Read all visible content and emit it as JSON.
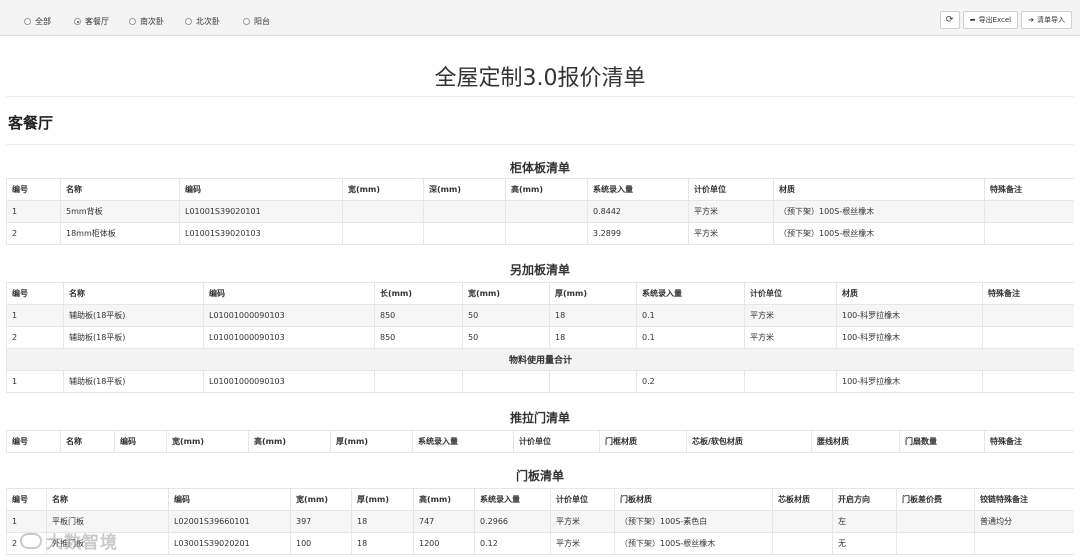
{
  "filters": {
    "options": [
      "全部",
      "客餐厅",
      "南次卧",
      "北次卧",
      "阳台"
    ],
    "selected": "客餐厅"
  },
  "toolbar": {
    "refresh_icon": "refresh-icon",
    "export_label": "导出Excel",
    "import_label": "清单导入"
  },
  "document": {
    "title": "全屋定制3.0报价清单",
    "room": "客餐厅"
  },
  "cabinet_board": {
    "title": "柜体板清单",
    "headers": [
      "编号",
      "名称",
      "编码",
      "宽(mm)",
      "深(mm)",
      "高(mm)",
      "系统录入量",
      "计价单位",
      "材质",
      "特殊备注"
    ],
    "rows": [
      [
        "1",
        "5mm背板",
        "L01001S39020101",
        "",
        "",
        "",
        "0.8442",
        "平方米",
        "（预下架）100S-根丝橡木",
        ""
      ],
      [
        "2",
        "18mm柜体板",
        "L01001S39020103",
        "",
        "",
        "",
        "3.2899",
        "平方米",
        "（预下架）100S-根丝橡木",
        ""
      ]
    ]
  },
  "extra_board": {
    "title": "另加板清单",
    "headers": [
      "编号",
      "名称",
      "编码",
      "长(mm)",
      "宽(mm)",
      "厚(mm)",
      "系统录入量",
      "计价单位",
      "材质",
      "特殊备注"
    ],
    "rows": [
      [
        "1",
        "辅助板(18平板)",
        "L01001000090103",
        "850",
        "50",
        "18",
        "0.1",
        "平方米",
        "100-科罗拉橡木",
        ""
      ],
      [
        "2",
        "辅助板(18平板)",
        "L01001000090103",
        "850",
        "50",
        "18",
        "0.1",
        "平方米",
        "100-科罗拉橡木",
        ""
      ]
    ],
    "summary_title": "物料使用量合计",
    "summary_rows": [
      [
        "1",
        "辅助板(18平板)",
        "L01001000090103",
        "",
        "",
        "",
        "0.2",
        "",
        "100-科罗拉橡木",
        ""
      ]
    ]
  },
  "sliding_door": {
    "title": "推拉门清单",
    "headers": [
      "编号",
      "名称",
      "编码",
      "宽(mm)",
      "高(mm)",
      "厚(mm)",
      "系统录入量",
      "计价单位",
      "门框材质",
      "芯板/软包材质",
      "腰线材质",
      "门扇数量",
      "特殊备注"
    ]
  },
  "door_panel": {
    "title": "门板清单",
    "headers": [
      "编号",
      "名称",
      "编码",
      "宽(mm)",
      "厚(mm)",
      "高(mm)",
      "系统录入量",
      "计价单位",
      "门板材质",
      "芯板材质",
      "开启方向",
      "门板差价费",
      "铰链特殊备注"
    ],
    "rows": [
      [
        "1",
        "平板门板",
        "L02001S39660101",
        "397",
        "18",
        "747",
        "0.2966",
        "平方米",
        "（预下架）100S-素色白",
        "",
        "左",
        "",
        "普通均分"
      ],
      [
        "2",
        "外推门板",
        "L03001S39020201",
        "100",
        "18",
        "1200",
        "0.12",
        "平方米",
        "（预下架）100S-根丝橡木",
        "",
        "无",
        "",
        ""
      ]
    ]
  },
  "watermark": "大数智境"
}
